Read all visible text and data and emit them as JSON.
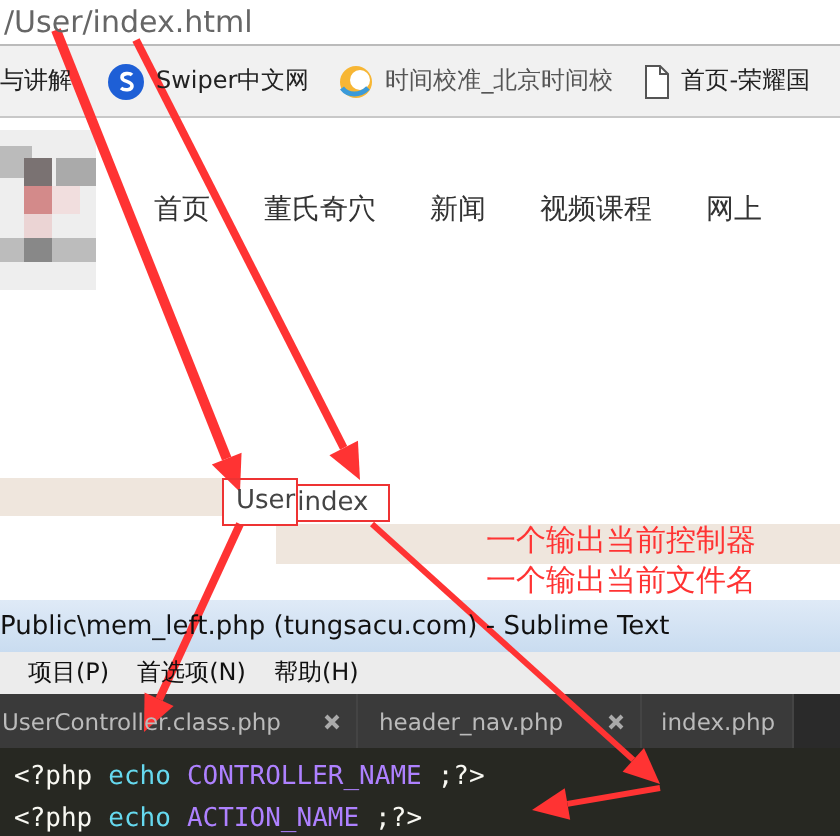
{
  "address_bar": {
    "url": "/User/index.html"
  },
  "bookmarks": [
    {
      "kind": "plain",
      "label": "与讲解"
    },
    {
      "kind": "swiper",
      "label": "Swiper中文网"
    },
    {
      "kind": "clock",
      "label": "时间校准_北京时间校"
    },
    {
      "kind": "page",
      "label": "首页-荣耀国"
    }
  ],
  "site_nav": [
    {
      "label": "首页"
    },
    {
      "label": "董氏奇穴"
    },
    {
      "label": "新闻"
    },
    {
      "label": "视频课程"
    },
    {
      "label": "网上"
    }
  ],
  "output": {
    "controller": "User",
    "action": "index"
  },
  "annotations": [
    {
      "text": "一个输出当前控制器"
    },
    {
      "text": "一个输出当前文件名"
    }
  ],
  "editor": {
    "title": "Public\\mem_left.php (tungsacu.com) - Sublime Text",
    "menu": [
      "项目(P)",
      "首选项(N)",
      "帮助(H)"
    ],
    "tabs": [
      {
        "label": "UserController.class.php",
        "closable": true
      },
      {
        "label": "header_nav.php",
        "closable": true
      },
      {
        "label": "index.php",
        "closable": false
      }
    ],
    "lines": [
      [
        {
          "kind": "tag",
          "text": "<?php"
        },
        {
          "kind": "keyword",
          "text": "echo"
        },
        {
          "kind": "constant",
          "text": "CONTROLLER_NAME"
        },
        {
          "kind": "tag",
          "text": ";?>"
        }
      ],
      [
        {
          "kind": "tag",
          "text": "<?php"
        },
        {
          "kind": "keyword",
          "text": "echo"
        },
        {
          "kind": "constant",
          "text": "ACTION_NAME"
        },
        {
          "kind": "tag",
          "text": ";?>"
        }
      ]
    ]
  }
}
